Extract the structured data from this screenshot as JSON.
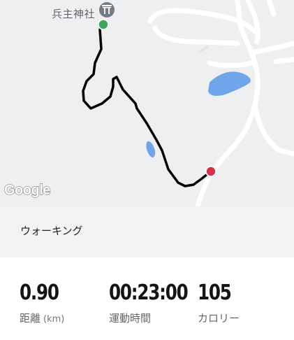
{
  "map": {
    "place_label": "兵主神社",
    "provider_logo": "Google",
    "shrine_icon": "torii-icon",
    "start_marker_color": "#3aa757",
    "end_marker_color": "#d8304a",
    "route_color": "#000000",
    "water_color": "#6fa5ea"
  },
  "activity": {
    "type_label": "ウォーキング"
  },
  "stats": [
    {
      "value": "0.90",
      "label": "距離",
      "unit": "(km)"
    },
    {
      "value": "00:23:00",
      "label": "運動時間",
      "unit": ""
    },
    {
      "value": "105",
      "label": "カロリー",
      "unit": ""
    }
  ]
}
